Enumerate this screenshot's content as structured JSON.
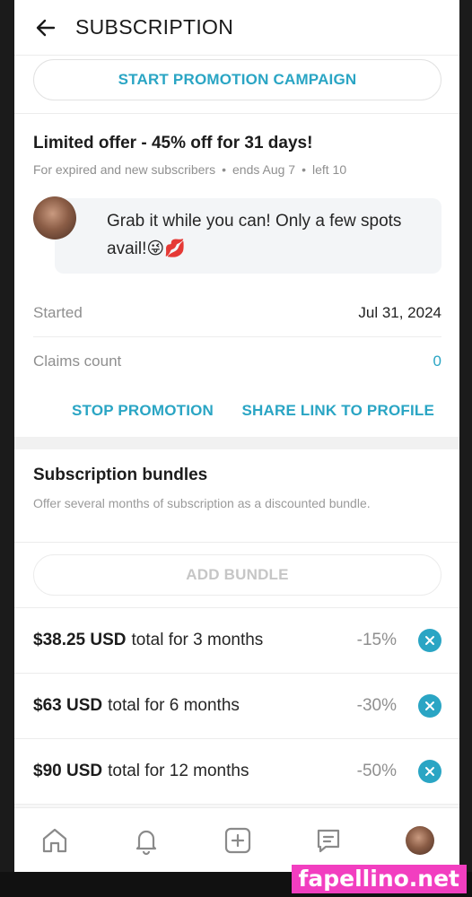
{
  "header": {
    "title": "SUBSCRIPTION"
  },
  "promo": {
    "start_campaign_label": "START PROMOTION CAMPAIGN"
  },
  "offer": {
    "title": "Limited offer - 45% off for 31 days!",
    "audience": "For expired and new subscribers",
    "ends": "ends Aug 7",
    "left": "left 10",
    "separator": "•",
    "message": "Grab it while you can! Only a few spots avail!😜💋"
  },
  "details": {
    "started_label": "Started",
    "started_value": "Jul 31, 2024",
    "claims_label": "Claims count",
    "claims_value": "0"
  },
  "actions": {
    "stop_label": "STOP PROMOTION",
    "share_label": "SHARE LINK TO PROFILE"
  },
  "bundles": {
    "title": "Subscription bundles",
    "description": "Offer several months of subscription as a discounted bundle.",
    "add_label": "ADD BUNDLE",
    "items": [
      {
        "price": "$38.25 USD",
        "text": "total for 3 months",
        "discount": "-15%"
      },
      {
        "price": "$63 USD",
        "text": "total for 6 months",
        "discount": "-30%"
      },
      {
        "price": "$90 USD",
        "text": "total for 12 months",
        "discount": "-50%"
      }
    ]
  },
  "tabbar": {
    "icons": [
      "home-icon",
      "bell-icon",
      "plus-square-icon",
      "chat-icon",
      "profile-avatar"
    ]
  },
  "watermark": "fapellino.net",
  "colors": {
    "accent": "#2aa5c4",
    "watermark_bg": "#f23ec0"
  }
}
